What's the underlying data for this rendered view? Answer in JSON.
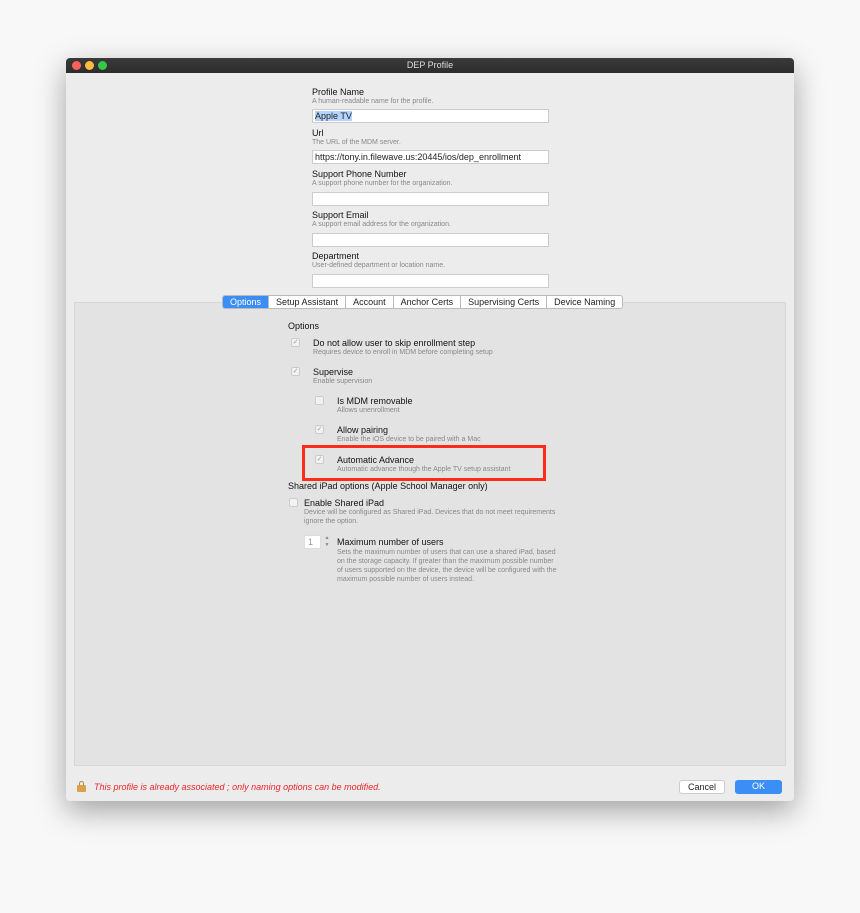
{
  "window": {
    "title": "DEP Profile"
  },
  "form": [
    {
      "label": "Profile Name",
      "hint": "A human-readable name for the profile.",
      "value": "Apple TV"
    },
    {
      "label": "Url",
      "hint": "The URL of the MDM server.",
      "value": "https://tony.in.filewave.us:20445/ios/dep_enrollment"
    },
    {
      "label": "Support Phone Number",
      "hint": "A support phone number for the organization.",
      "value": ""
    },
    {
      "label": "Support Email",
      "hint": "A support email address for the organization.",
      "value": ""
    },
    {
      "label": "Department",
      "hint": "User-defined department or location name.",
      "value": ""
    }
  ],
  "tabs": [
    "Options",
    "Setup Assistant",
    "Account",
    "Anchor Certs",
    "Supervising Certs",
    "Device Naming"
  ],
  "active_tab": "Options",
  "options": {
    "heading": "Options",
    "items": [
      {
        "label": "Do not allow user to skip enrollment step",
        "hint": "Requires device to enroll in MDM before completing setup",
        "checked": true
      },
      {
        "label": "Supervise",
        "hint": "Enable supervision",
        "checked": true
      },
      {
        "label": "Is MDM removable",
        "hint": "Allows unenrollment",
        "checked": false
      },
      {
        "label": "Allow pairing",
        "hint": "Enable the iOS device to be paired with a Mac",
        "checked": true
      },
      {
        "label": "Automatic Advance",
        "hint": "Automatic advance though the Apple TV setup assistant",
        "checked": true
      }
    ],
    "shared_heading": "Shared iPad options (Apple School Manager only)",
    "shared": {
      "label": "Enable Shared iPad",
      "hint1": "Device will be configured as Shared iPad. Devices that do not meet requirements",
      "hint2": "ignore the option.",
      "checked": false
    },
    "max_users": {
      "label": "Maximum number of users",
      "value": "1",
      "hint": [
        "Sets the maximum number of users that can use a shared iPad, based",
        "on the storage capacity. If greater than the maximum possible number",
        "of users supported on the device, the device will be configured with the",
        "maximum possible number of users instead."
      ]
    }
  },
  "footer": {
    "message": "This profile is already associated ; only naming options can be modified.",
    "cancel": "Cancel",
    "ok": "OK"
  },
  "colors": {
    "accent": "#3b8ef5",
    "warning": "#e8262a",
    "highlight_box": "#ff2a1a"
  }
}
